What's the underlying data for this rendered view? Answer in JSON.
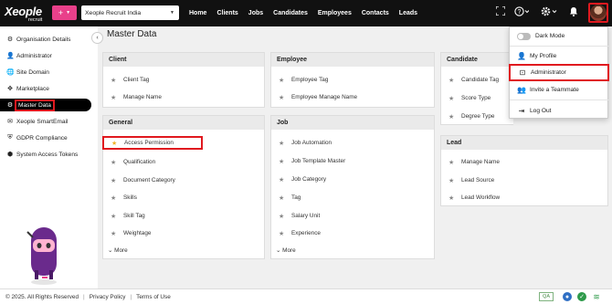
{
  "brand": {
    "logo_text": "Xeople",
    "logo_sub": "recruit"
  },
  "header": {
    "plus_label": "+",
    "company": "Xeople Recruit India",
    "nav": [
      "Home",
      "Clients",
      "Jobs",
      "Candidates",
      "Employees",
      "Contacts",
      "Leads"
    ]
  },
  "sidebar": {
    "items": [
      {
        "label": "Organisation Details",
        "icon": "building-icon"
      },
      {
        "label": "Administrator",
        "icon": "person-icon"
      },
      {
        "label": "Site Domain",
        "icon": "globe-icon"
      },
      {
        "label": "Marketplace",
        "icon": "puzzle-icon"
      },
      {
        "label": "Master Data",
        "icon": "gear-icon"
      },
      {
        "label": "Xeople SmartEmail",
        "icon": "email-icon"
      },
      {
        "label": "GDPR Compliance",
        "icon": "shield-icon"
      },
      {
        "label": "System Access Tokens",
        "icon": "cube-icon"
      }
    ]
  },
  "main": {
    "title": "Master Data",
    "more_label": "More",
    "client": {
      "title": "Client",
      "items": [
        "Client Tag",
        "Manage Name"
      ]
    },
    "employee": {
      "title": "Employee",
      "items": [
        "Employee Tag",
        "Employee Manage Name"
      ]
    },
    "candidate": {
      "title": "Candidate",
      "items": [
        "Candidate Tag",
        "Score Type",
        "Degree Type"
      ]
    },
    "general": {
      "title": "General",
      "items": [
        "Access Permission",
        "Qualification",
        "Document Category",
        "Skills",
        "Skill Tag",
        "Weightage"
      ]
    },
    "job": {
      "title": "Job",
      "items": [
        "Job Automation",
        "Job Template Master",
        "Job Category",
        "Tag",
        "Salary Unit",
        "Experience"
      ]
    },
    "lead": {
      "title": "Lead",
      "items": [
        "Manage Name",
        "Lead Source",
        "Lead Workflow"
      ]
    }
  },
  "dropdown": {
    "dark_mode": "Dark Mode",
    "my_profile": "My Profile",
    "administrator": "Administrator",
    "invite": "Invite a Teammate",
    "logout": "Log Out"
  },
  "footer": {
    "copyright": "© 2025. All Rights Reserved",
    "privacy": "Privacy Policy",
    "terms": "Terms of Use",
    "qa": "QA"
  },
  "colors": {
    "accent": "#e9408a",
    "highlight": "#e0191f",
    "topbar": "#111111"
  }
}
